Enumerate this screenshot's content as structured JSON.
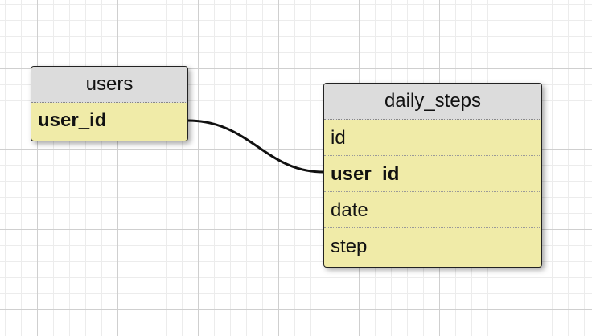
{
  "tables": {
    "users": {
      "title": "users",
      "fields": [
        {
          "label": "user_id",
          "key": true
        }
      ]
    },
    "daily_steps": {
      "title": "daily_steps",
      "fields": [
        {
          "label": "id",
          "key": false
        },
        {
          "label": "user_id",
          "key": true
        },
        {
          "label": "date",
          "key": false
        },
        {
          "label": "step",
          "key": false
        }
      ]
    }
  },
  "relations": [
    {
      "from": "users.user_id",
      "to": "daily_steps.user_id"
    }
  ]
}
